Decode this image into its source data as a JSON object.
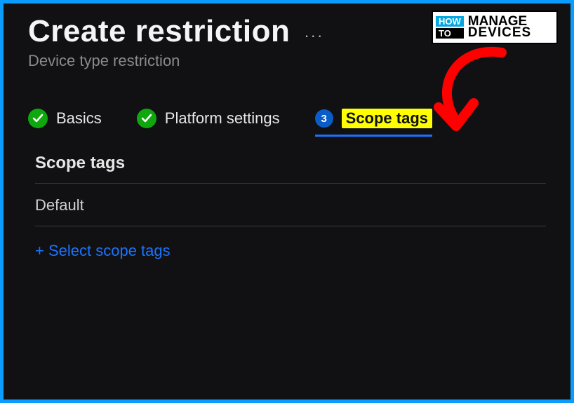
{
  "header": {
    "title": "Create restriction",
    "subtitle": "Device type restriction",
    "more": "···"
  },
  "stepper": {
    "steps": [
      {
        "label": "Basics",
        "status": "done"
      },
      {
        "label": "Platform settings",
        "status": "done"
      },
      {
        "label": "Scope tags",
        "status": "active",
        "number": "3"
      }
    ]
  },
  "scope": {
    "section_title": "Scope tags",
    "rows": [
      "Default"
    ],
    "add_label": "+ Select scope tags"
  },
  "watermark": {
    "how": "HOW",
    "to": "TO",
    "line1": "MANAGE",
    "line2": "DEVICES"
  }
}
